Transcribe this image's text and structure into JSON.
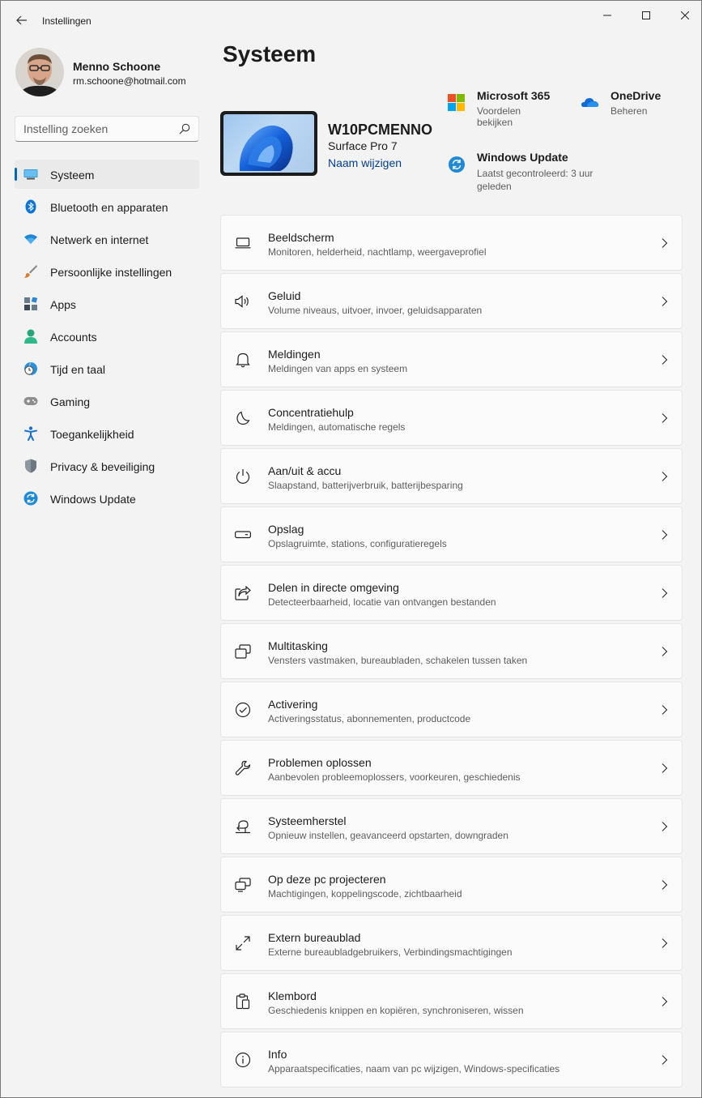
{
  "window": {
    "title": "Instellingen"
  },
  "profile": {
    "name": "Menno Schoone",
    "email": "rm.schoone@hotmail.com"
  },
  "search": {
    "placeholder": "Instelling zoeken"
  },
  "accent_color": "#0067c0",
  "link_color": "#003e92",
  "sidebar": {
    "items": [
      {
        "label": "Systeem",
        "icon": "monitor-icon",
        "active": true
      },
      {
        "label": "Bluetooth en apparaten",
        "icon": "bluetooth-icon"
      },
      {
        "label": "Netwerk en internet",
        "icon": "wifi-icon"
      },
      {
        "label": "Persoonlijke instellingen",
        "icon": "brush-icon"
      },
      {
        "label": "Apps",
        "icon": "apps-icon"
      },
      {
        "label": "Accounts",
        "icon": "person-icon"
      },
      {
        "label": "Tijd en taal",
        "icon": "clock-globe-icon"
      },
      {
        "label": "Gaming",
        "icon": "gamepad-icon"
      },
      {
        "label": "Toegankelijkheid",
        "icon": "accessibility-icon"
      },
      {
        "label": "Privacy & beveiliging",
        "icon": "shield-icon"
      },
      {
        "label": "Windows Update",
        "icon": "update-icon"
      }
    ]
  },
  "main": {
    "title": "Systeem",
    "device": {
      "name": "W10PCMENNO",
      "model": "Surface Pro 7",
      "rename_link": "Naam wijzigen"
    },
    "quick_links": [
      {
        "title": "Microsoft 365",
        "subtitle": "Voordelen bekijken",
        "icon": "microsoft-logo-icon"
      },
      {
        "title": "OneDrive",
        "subtitle": "Beheren",
        "icon": "onedrive-cloud-icon"
      },
      {
        "title": "Windows Update",
        "subtitle": "Laatst gecontroleerd: 3 uur geleden",
        "icon": "update-icon"
      }
    ],
    "settings": [
      {
        "title": "Beeldscherm",
        "subtitle": "Monitoren, helderheid, nachtlamp, weergaveprofiel",
        "icon": "laptop-icon"
      },
      {
        "title": "Geluid",
        "subtitle": "Volume niveaus, uitvoer, invoer, geluidsapparaten",
        "icon": "speaker-icon"
      },
      {
        "title": "Meldingen",
        "subtitle": "Meldingen van apps en systeem",
        "icon": "bell-icon"
      },
      {
        "title": "Concentratiehulp",
        "subtitle": "Meldingen, automatische regels",
        "icon": "moon-icon"
      },
      {
        "title": "Aan/uit & accu",
        "subtitle": "Slaapstand, batterijverbruik, batterijbesparing",
        "icon": "power-icon"
      },
      {
        "title": "Opslag",
        "subtitle": "Opslagruimte, stations, configuratieregels",
        "icon": "storage-icon"
      },
      {
        "title": "Delen in directe omgeving",
        "subtitle": "Detecteerbaarheid, locatie van ontvangen bestanden",
        "icon": "share-icon"
      },
      {
        "title": "Multitasking",
        "subtitle": "Vensters vastmaken, bureaubladen, schakelen tussen taken",
        "icon": "multitasking-icon"
      },
      {
        "title": "Activering",
        "subtitle": "Activeringsstatus, abonnementen, productcode",
        "icon": "checkmark-circle-icon"
      },
      {
        "title": "Problemen oplossen",
        "subtitle": "Aanbevolen probleemoplossers, voorkeuren, geschiedenis",
        "icon": "wrench-icon"
      },
      {
        "title": "Systeemherstel",
        "subtitle": "Opnieuw instellen, geavanceerd opstarten, downgraden",
        "icon": "recovery-icon"
      },
      {
        "title": "Op deze pc projecteren",
        "subtitle": "Machtigingen, koppelingscode, zichtbaarheid",
        "icon": "project-icon"
      },
      {
        "title": "Extern bureaublad",
        "subtitle": "Externe bureaubladgebruikers, Verbindingsmachtigingen",
        "icon": "remote-desktop-icon"
      },
      {
        "title": "Klembord",
        "subtitle": "Geschiedenis knippen en kopiëren, synchroniseren, wissen",
        "icon": "clipboard-icon"
      },
      {
        "title": "Info",
        "subtitle": "Apparaatspecificaties, naam van pc wijzigen, Windows-specificaties",
        "icon": "info-icon"
      }
    ]
  }
}
